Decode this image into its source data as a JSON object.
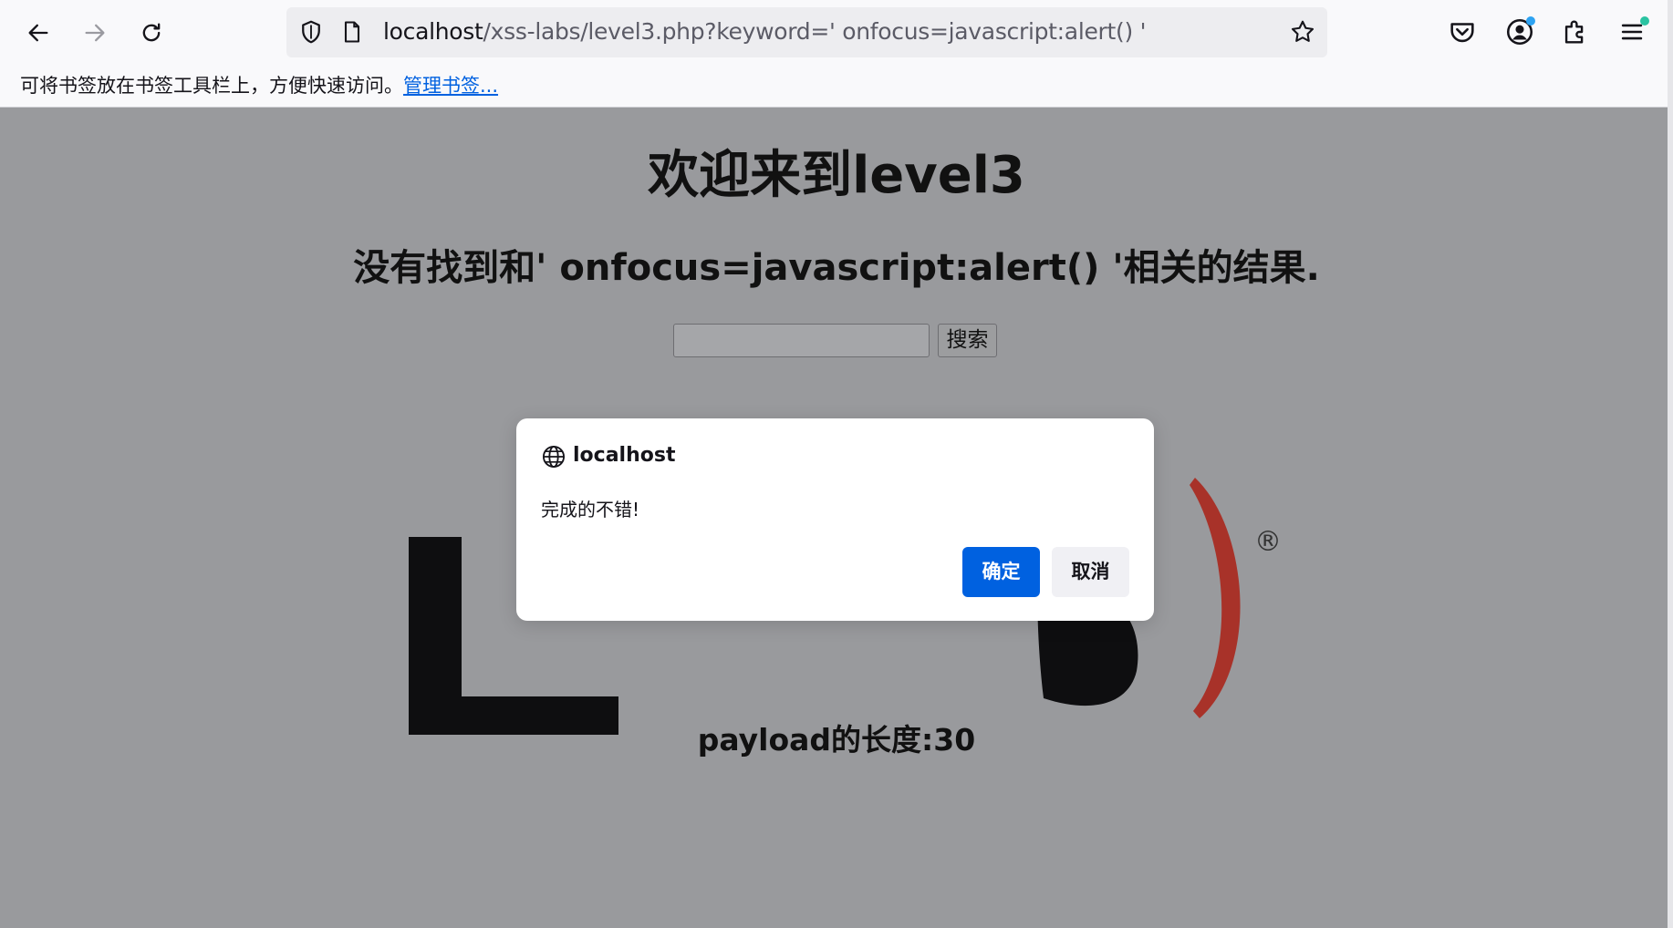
{
  "browser": {
    "url_host": "localhost",
    "url_path": "/xss-labs/level3.php?keyword=' onfocus=javascript:alert() '",
    "bookmarks_hint": "可将书签放在书签工具栏上，方便快速访问。",
    "bookmarks_link": "管理书签...",
    "icons": [
      "back-icon",
      "forward-icon",
      "reload-icon",
      "shield-icon",
      "page-icon",
      "star-icon",
      "pocket-icon",
      "account-icon",
      "extensions-icon",
      "menu-icon"
    ],
    "accent": "#0061e0"
  },
  "page": {
    "title": "欢迎来到level3",
    "result": "没有找到和' onfocus=javascript:alert() '相关的结果.",
    "search_value": "",
    "search_button": "搜索",
    "logo_registered": "®",
    "payload_length": "payload的长度:30"
  },
  "dialog": {
    "origin": "localhost",
    "message": "完成的不错!",
    "ok_label": "确定",
    "cancel_label": "取消"
  }
}
